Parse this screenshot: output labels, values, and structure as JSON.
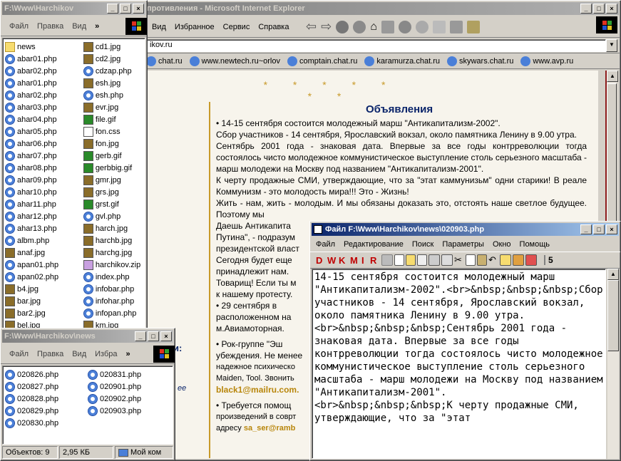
{
  "ie": {
    "title": "противления - Microsoft Internet Explorer",
    "menu": [
      "Вид",
      "Избранное",
      "Сервис",
      "Справка"
    ],
    "address": "ikov.ru",
    "links": [
      "chat.ru",
      "www.newtech.ru~orlov",
      "comptain.chat.ru",
      "karamurza.chat.ru",
      "skywars.chat.ru",
      "www.avp.ru"
    ],
    "heading": "Объявления",
    "stars": "* * * * * * *",
    "paras": [
      "•     14-15 сентября состоится молодежный марш \"Антикапитализм-2002\".",
      "   Сбор участников - 14 сентября, Ярославский вокзал, около памятника Ленину в 9.00 утра.",
      "   Сентябрь 2001 года - знаковая дата. Впервые за все годы контрреволюции тогда состоялось чисто молодежное коммунистическое выступление столь серьезного масштаба - марш молодежи на Москву под названием \"Антикапитализм-2001\".",
      "   К черту продажные СМИ, утверждающие, что за \"этат каммунизьм\" одни старики! В реале Коммунизм - это молодость мира!!! Это - Жизнь!",
      "   Жить - нам, жить - молодым. И мы обязаны доказать это, отстоять наше светлое будущее. Поэтому мы",
      "   Даешь Антикапита",
      "Путина\", - подразум",
      "президентской власт",
      "Сегодня будет еще",
      "принадлежит нам.",
      "   Товарищ! Если ты м",
      "к нашему протесту.",
      "•     29 сентября в",
      "расположенном на",
      "м.Авиамоторная."
    ],
    "left_frag": "и:",
    "left_frag2": "ee",
    "paras2": [
      "•     Рок-группе \"Эш",
      "убеждения. Не менее",
      "надежное психическо",
      "Maiden, Tool. Звонить"
    ],
    "email1": "black1@mailru.com.",
    "paras3": [
      "•     Требуется помощ",
      "произведений в соврт",
      "адресу"
    ],
    "email2": "sa_ser@ramb"
  },
  "ex1": {
    "title": "F:\\Www\\Harchikov",
    "menu": [
      "Файл",
      "Правка",
      "Вид"
    ],
    "chev": "»",
    "col1": [
      {
        "n": "news",
        "t": "folder"
      },
      {
        "n": "abar01.php",
        "t": "php"
      },
      {
        "n": "abar02.php",
        "t": "php"
      },
      {
        "n": "ahar01.php",
        "t": "php"
      },
      {
        "n": "ahar02.php",
        "t": "php"
      },
      {
        "n": "ahar03.php",
        "t": "php"
      },
      {
        "n": "ahar04.php",
        "t": "php"
      },
      {
        "n": "ahar05.php",
        "t": "php"
      },
      {
        "n": "ahar06.php",
        "t": "php"
      },
      {
        "n": "ahar07.php",
        "t": "php"
      },
      {
        "n": "ahar08.php",
        "t": "php"
      },
      {
        "n": "ahar09.php",
        "t": "php"
      },
      {
        "n": "ahar10.php",
        "t": "php"
      },
      {
        "n": "ahar11.php",
        "t": "php"
      },
      {
        "n": "ahar12.php",
        "t": "php"
      },
      {
        "n": "ahar13.php",
        "t": "php"
      },
      {
        "n": "albm.php",
        "t": "php"
      },
      {
        "n": "anaf.jpg",
        "t": "jpg"
      },
      {
        "n": "apan01.php",
        "t": "php"
      },
      {
        "n": "apan02.php",
        "t": "php"
      },
      {
        "n": "b4.jpg",
        "t": "jpg"
      },
      {
        "n": "bar.jpg",
        "t": "jpg"
      },
      {
        "n": "bar2.jpg",
        "t": "jpg"
      },
      {
        "n": "bel.jpg",
        "t": "jpg"
      }
    ],
    "col2": [
      {
        "n": "cd1.jpg",
        "t": "jpg"
      },
      {
        "n": "cd2.jpg",
        "t": "jpg"
      },
      {
        "n": "cdzap.php",
        "t": "php"
      },
      {
        "n": "esh.jpg",
        "t": "jpg"
      },
      {
        "n": "esh.php",
        "t": "php"
      },
      {
        "n": "evr.jpg",
        "t": "jpg"
      },
      {
        "n": "file.gif",
        "t": "gif"
      },
      {
        "n": "fon.css",
        "t": "css"
      },
      {
        "n": "fon.jpg",
        "t": "jpg"
      },
      {
        "n": "gerb.gif",
        "t": "gif"
      },
      {
        "n": "gerbbig.gif",
        "t": "gif"
      },
      {
        "n": "gmr.jpg",
        "t": "jpg"
      },
      {
        "n": "grs.jpg",
        "t": "jpg"
      },
      {
        "n": "grst.gif",
        "t": "gif"
      },
      {
        "n": "gvl.php",
        "t": "php"
      },
      {
        "n": "harch.jpg",
        "t": "jpg"
      },
      {
        "n": "harchb.jpg",
        "t": "jpg"
      },
      {
        "n": "harchg.jpg",
        "t": "jpg"
      },
      {
        "n": "harchikov.zip",
        "t": "zip"
      },
      {
        "n": "index.php",
        "t": "php"
      },
      {
        "n": "infobar.php",
        "t": "php"
      },
      {
        "n": "infohar.php",
        "t": "php"
      },
      {
        "n": "infopan.php",
        "t": "php"
      },
      {
        "n": "km.jpg",
        "t": "jpg"
      }
    ]
  },
  "ex2": {
    "title": "F:\\Www\\Harchikov\\news",
    "menu": [
      "Файл",
      "Правка",
      "Вид",
      "Избра"
    ],
    "chev": "»",
    "col1": [
      "020826.php",
      "020827.php",
      "020828.php",
      "020829.php",
      "020830.php"
    ],
    "col2": [
      "020831.php",
      "020901.php",
      "020902.php",
      "020903.php"
    ],
    "status": [
      "Объектов: 9",
      "2,95 КБ",
      "Мой ком"
    ]
  },
  "ed": {
    "title": "Файл F:\\Www\\Harchikov\\news\\020903.php",
    "menu": [
      "Файл",
      "Редактирование",
      "Поиск",
      "Параметры",
      "Окно",
      "Помощь"
    ],
    "tbtext": [
      "D",
      "W",
      "K",
      "M",
      "I",
      "R"
    ],
    "num": "5",
    "text": "14-15 сентября состоится молодежный марш \"Антикапитализм-2002\".<br>&nbsp;&nbsp;&nbsp;Сбор участников - 14 сентября, Ярославский вокзал, около памятника Ленину в 9.00 утра.<br>&nbsp;&nbsp;&nbsp;Сентябрь 2001 года - знаковая дата. Впервые за все годы контрреволюции тогда состоялось чисто молодежное коммунистическое выступление столь серьезного масштаба - марш молодежи на Москву под названием \"Антикапитализм-2001\".\n<br>&nbsp;&nbsp;&nbsp;К черту продажные СМИ, утверждающие, что за \"этат"
  },
  "colors": {
    "titleActive": "#0a246a",
    "accent": "#c89a2a",
    "heading": "#0a246a",
    "email": "#b8860b"
  }
}
